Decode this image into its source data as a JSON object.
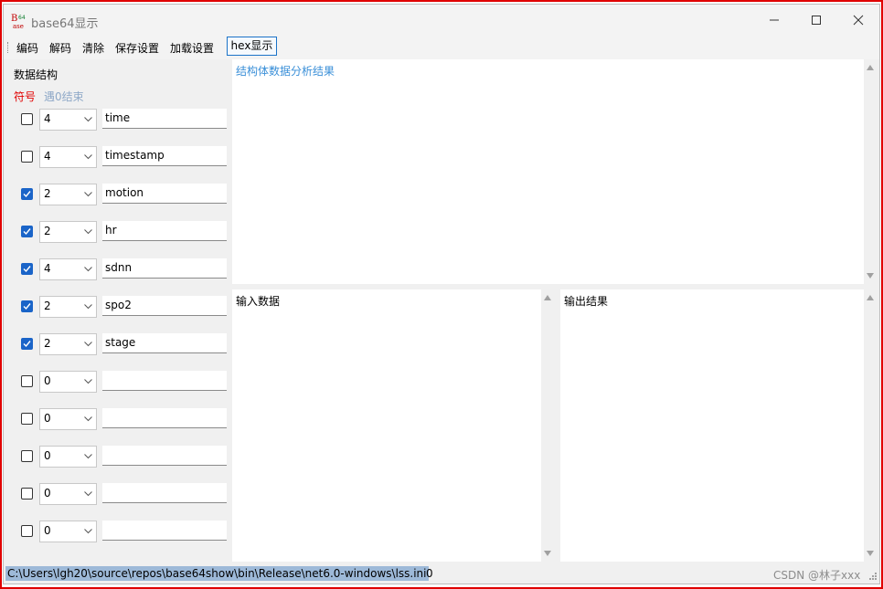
{
  "window": {
    "title": "base64显示"
  },
  "menu": {
    "items": [
      "编码",
      "解码",
      "清除",
      "保存设置",
      "加载设置"
    ],
    "hex_button": "hex显示"
  },
  "left": {
    "section_title": "数据结构",
    "symbol_label": "符号",
    "zero_end_label": "遇0结束"
  },
  "rows": [
    {
      "checked": false,
      "size": "4",
      "name": "time"
    },
    {
      "checked": false,
      "size": "4",
      "name": "timestamp"
    },
    {
      "checked": true,
      "size": "2",
      "name": "motion"
    },
    {
      "checked": true,
      "size": "2",
      "name": "hr"
    },
    {
      "checked": true,
      "size": "4",
      "name": "sdnn"
    },
    {
      "checked": true,
      "size": "2",
      "name": "spo2"
    },
    {
      "checked": true,
      "size": "2",
      "name": "stage"
    },
    {
      "checked": false,
      "size": "0",
      "name": ""
    },
    {
      "checked": false,
      "size": "0",
      "name": ""
    },
    {
      "checked": false,
      "size": "0",
      "name": ""
    },
    {
      "checked": false,
      "size": "0",
      "name": ""
    },
    {
      "checked": false,
      "size": "0",
      "name": ""
    }
  ],
  "panes": {
    "analysis": "结构体数据分析结果",
    "input": "输入数据",
    "output": "输出结果"
  },
  "status": {
    "path": "C:\\Users\\lgh20\\source\\repos\\base64show\\bin\\Release\\net6.0-windows\\lss.ini",
    "count": "0"
  },
  "watermark": "CSDN @林子xxx",
  "colors": {
    "symbol_label": "#e00000",
    "zero_end_label": "#8fa9c8",
    "analysis_text": "#3a8fd8",
    "checkbox": "#1a64c8"
  }
}
